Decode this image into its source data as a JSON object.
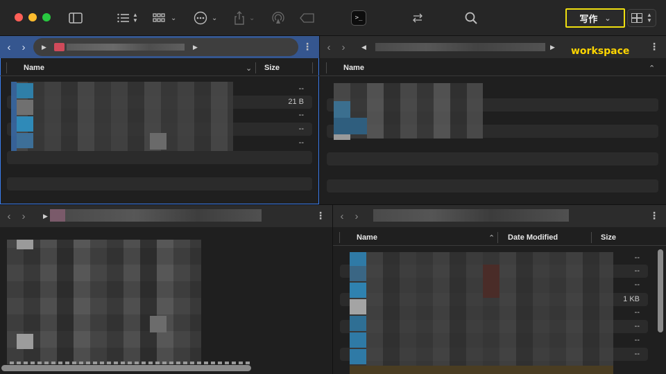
{
  "toolbar": {
    "profile_label": "写作",
    "icons": [
      "sidebar-icon",
      "list-view-icon",
      "grid-view-icon",
      "more-actions-icon",
      "share-icon",
      "airdrop-icon",
      "tag-icon",
      "terminal-icon",
      "swap-panes-icon",
      "search-icon",
      "layout-icon"
    ]
  },
  "annotation": {
    "workspace": "workspace"
  },
  "pane_top_left": {
    "columns": {
      "name": "Name",
      "size": "Size"
    },
    "rows": [
      {
        "size": "--"
      },
      {
        "size": "21 B"
      },
      {
        "size": "--"
      },
      {
        "size": "--"
      },
      {
        "size": "--"
      }
    ]
  },
  "pane_top_right": {
    "columns": {
      "name": "Name"
    }
  },
  "pane_bottom_right": {
    "columns": {
      "name": "Name",
      "date_modified": "Date Modified",
      "size": "Size"
    },
    "rows": [
      {
        "size": "--"
      },
      {
        "size": "--"
      },
      {
        "size": "--"
      },
      {
        "size": "1 KB"
      },
      {
        "size": "--"
      },
      {
        "size": "--"
      },
      {
        "size": "--"
      },
      {
        "size": "--"
      }
    ]
  },
  "colors": {
    "accent": "#3a7ef0",
    "highlight": "#f0e010",
    "workspace_text": "#ffd600"
  }
}
